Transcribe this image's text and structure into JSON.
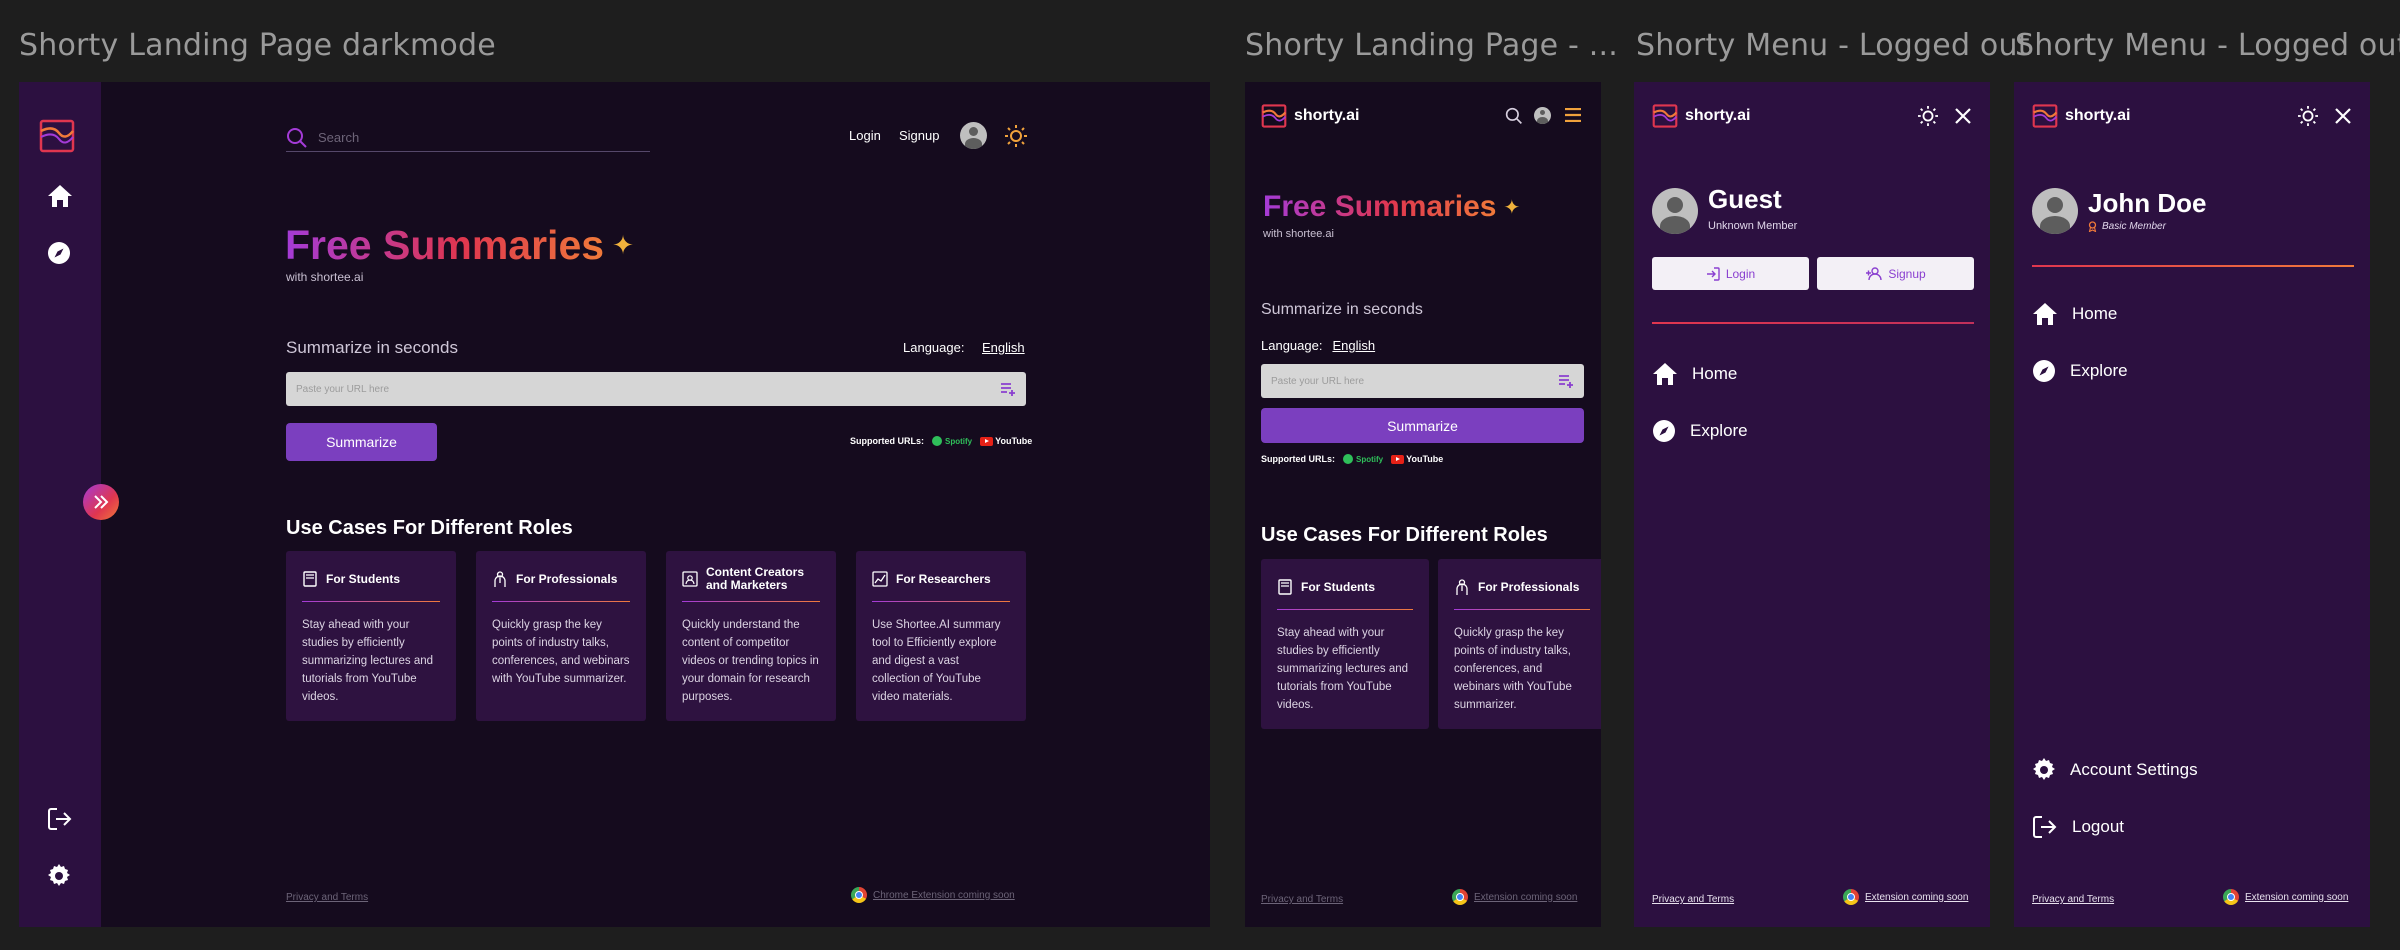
{
  "frames": {
    "f1_title": "Shorty Landing Page darkmode",
    "f2_title": "Shorty Landing Page - ...",
    "f3_title": "Shorty Menu - Logged out",
    "f4_title": "Shorty Menu - Logged out"
  },
  "brand": {
    "name": "shorty.ai"
  },
  "header": {
    "search_placeholder": "Search",
    "login": "Login",
    "signup": "Signup"
  },
  "hero": {
    "title": "Free Summaries",
    "sparkle": "✦",
    "subtitle": "with shortee.ai"
  },
  "summarize": {
    "heading": "Summarize in seconds",
    "language_label": "Language:",
    "language_value": "English",
    "url_placeholder": "Paste your URL here",
    "button": "Summarize",
    "supported_label": "Supported URLs:",
    "spotify": "Spotify",
    "youtube": "YouTube"
  },
  "use_cases": {
    "heading": "Use Cases For Different Roles",
    "cards": [
      {
        "title": "For Students",
        "text": "Stay ahead with your studies by efficiently summarizing lectures and tutorials from YouTube videos."
      },
      {
        "title": "For Professionals",
        "text": "Quickly grasp the key points of industry talks, conferences, and webinars with YouTube summarizer."
      },
      {
        "title": "Content Creators and Marketers",
        "text": "Quickly understand the content of competitor videos or trending topics in your domain for research purposes."
      },
      {
        "title": "For Researchers",
        "text": "Use Shortee.AI summary tool to Efficiently explore and digest a vast collection of YouTube video materials."
      }
    ]
  },
  "footer": {
    "privacy": "Privacy and Terms",
    "chrome_ext": "Chrome Extension coming soon",
    "ext": "Extension coming soon"
  },
  "menu_guest": {
    "name": "Guest",
    "member": "Unknown Member",
    "login": "Login",
    "signup": "Signup",
    "home": "Home",
    "explore": "Explore"
  },
  "menu_user": {
    "name": "John Doe",
    "member": "Basic Member",
    "home": "Home",
    "explore": "Explore",
    "account_settings": "Account Settings",
    "logout": "Logout"
  },
  "colors": {
    "accent_purple": "#7b3fbf",
    "gradient_start": "#a43bd8",
    "gradient_mid": "#e0364f",
    "gradient_end": "#f07a3a",
    "dark_bg": "#150b1e",
    "menu_bg": "#2c1040"
  }
}
